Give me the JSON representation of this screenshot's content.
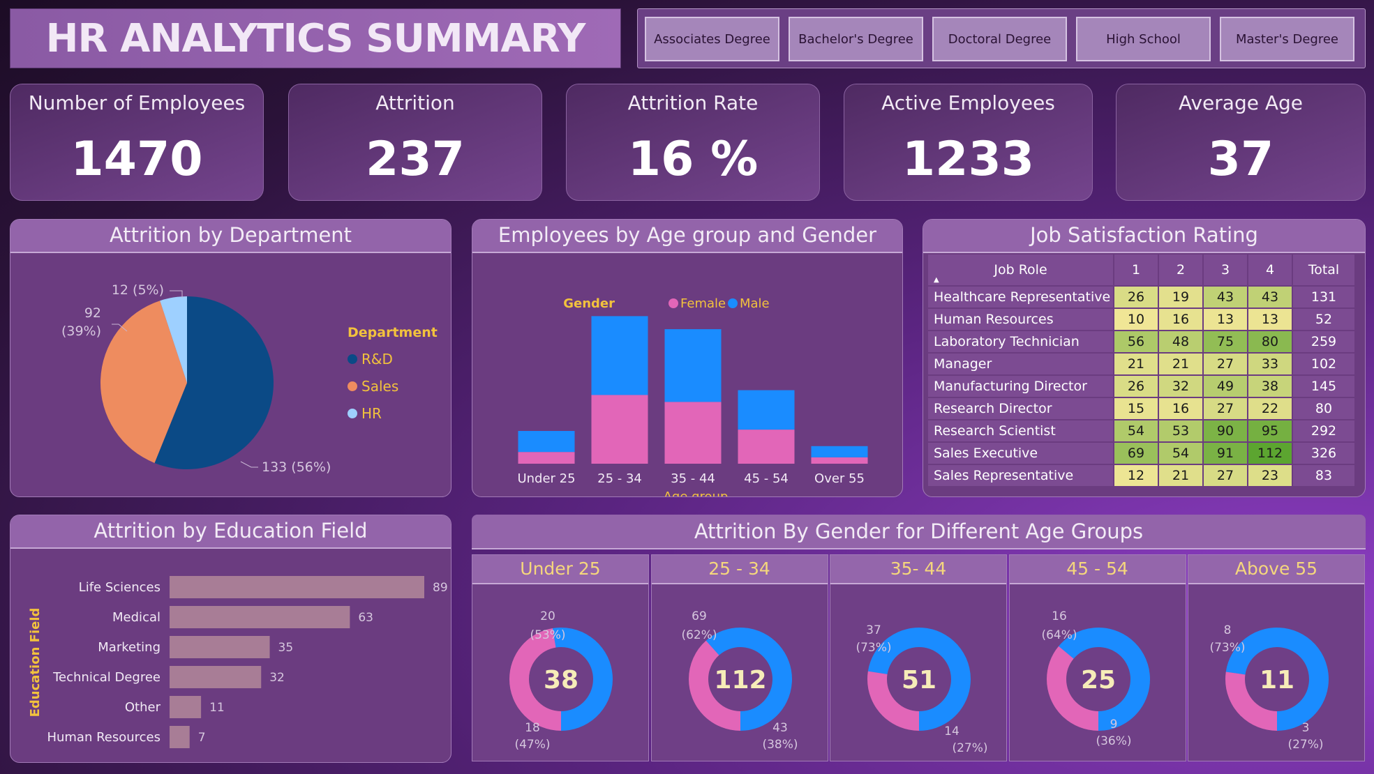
{
  "title": "HR ANALYTICS SUMMARY",
  "slicer": [
    "Associates Degree",
    "Bachelor's Degree",
    "Doctoral Degree",
    "High School",
    "Master's Degree"
  ],
  "kpis": [
    {
      "label": "Number of Employees",
      "value": "1470"
    },
    {
      "label": "Attrition",
      "value": "237"
    },
    {
      "label": "Attrition Rate",
      "value": "16 %"
    },
    {
      "label": "Active Employees",
      "value": "1233"
    },
    {
      "label": "Average Age",
      "value": "37"
    }
  ],
  "colors": {
    "female": "#e266b8",
    "male": "#1a8cff",
    "rnd": "#0b4a86",
    "sales": "#ee8c5f",
    "hr": "#9ed0ff",
    "edu_bar": "#a87d96",
    "gold": "#f2c23d"
  },
  "chart_data": [
    {
      "type": "pie",
      "title": "Attrition by Department",
      "legend_title": "Department",
      "legend_position": "right",
      "slices": [
        {
          "name": "R&D",
          "value": 133,
          "label": "133 (56%)"
        },
        {
          "name": "Sales",
          "value": 92,
          "label_line1": "92",
          "label_line2": "(39%)"
        },
        {
          "name": "HR",
          "value": 12,
          "label": "12 (5%)"
        }
      ]
    },
    {
      "type": "bar",
      "stacked": true,
      "title": "Employees by Age group and Gender",
      "legend_title": "Gender",
      "legend_position": "top",
      "xlabel": "Age group",
      "categories": [
        "Under 25",
        "25 - 34",
        "35 - 44",
        "45 - 54",
        "Over 55"
      ],
      "series": [
        {
          "name": "Female",
          "values": [
            44,
            258,
            232,
            128,
            24
          ]
        },
        {
          "name": "Male",
          "values": [
            79,
            296,
            273,
            148,
            42
          ]
        }
      ]
    },
    {
      "type": "table",
      "title": "Job Satisfaction Rating",
      "columns": [
        "Job Role",
        "1",
        "2",
        "3",
        "4",
        "Total"
      ],
      "rows": [
        [
          "Healthcare Representative",
          26,
          19,
          43,
          43,
          131
        ],
        [
          "Human Resources",
          10,
          16,
          13,
          13,
          52
        ],
        [
          "Laboratory Technician",
          56,
          48,
          75,
          80,
          259
        ],
        [
          "Manager",
          21,
          21,
          27,
          33,
          102
        ],
        [
          "Manufacturing Director",
          26,
          32,
          49,
          38,
          145
        ],
        [
          "Research Director",
          15,
          16,
          27,
          22,
          80
        ],
        [
          "Research Scientist",
          54,
          53,
          90,
          95,
          292
        ],
        [
          "Sales Executive",
          69,
          54,
          91,
          112,
          326
        ],
        [
          "Sales Representative",
          12,
          21,
          27,
          23,
          83
        ]
      ]
    },
    {
      "type": "bar",
      "orientation": "horizontal",
      "title": "Attrition by Education Field",
      "ylabel": "Education Field",
      "categories": [
        "Life Sciences",
        "Medical",
        "Marketing",
        "Technical Degree",
        "Other",
        "Human Resources"
      ],
      "values": [
        89,
        63,
        35,
        32,
        11,
        7
      ]
    },
    {
      "type": "pie",
      "subtype": "donut",
      "title": "Attrition By Gender for Different Age Groups",
      "groups": [
        {
          "name": "Under 25",
          "total": 38,
          "male": 20,
          "female": 18,
          "male_pct": "(53%)",
          "female_pct": "(47%)"
        },
        {
          "name": "25 - 34",
          "total": 112,
          "male": 69,
          "female": 43,
          "male_pct": "(62%)",
          "female_pct": "(38%)"
        },
        {
          "name": "35- 44",
          "total": 51,
          "male": 37,
          "female": 14,
          "male_pct": "(73%)",
          "female_pct": "(27%)"
        },
        {
          "name": "45 - 54",
          "total": 25,
          "male": 16,
          "female": 9,
          "male_pct": "(64%)",
          "female_pct": "(36%)"
        },
        {
          "name": "Above 55",
          "total": 11,
          "male": 8,
          "female": 3,
          "male_pct": "(73%)",
          "female_pct": "(27%)"
        }
      ]
    }
  ]
}
